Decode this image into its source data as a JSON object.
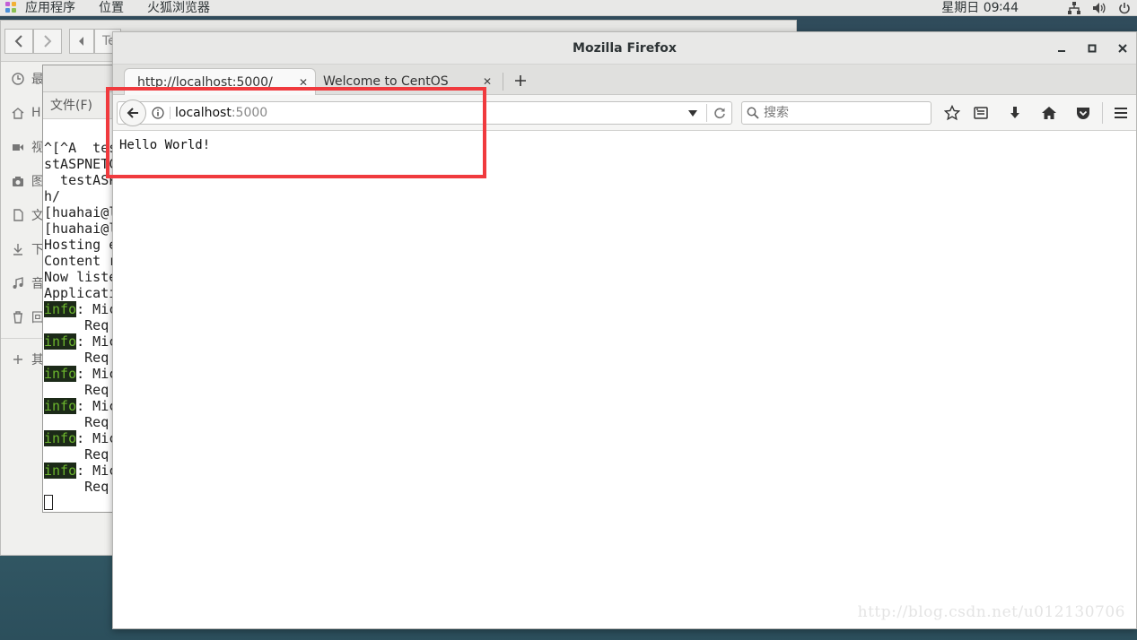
{
  "topbar": {
    "apps_label": "应用程序",
    "places_label": "位置",
    "browser_label": "火狐浏览器",
    "clock": "星期日 09∶44"
  },
  "file_manager": {
    "sidebar_items": [
      "最",
      "H",
      "视",
      "图",
      "文",
      "下",
      "音",
      "回",
      "其"
    ],
    "tab_hint": "Te"
  },
  "terminal": {
    "menu_file": "文件(F)",
    "lines": [
      "^[^A  tes",
      "stASPNETC",
      "  testASP",
      "h/",
      "[huahai@l",
      "[huahai@l",
      "Hosting e",
      "Content r",
      "Now liste",
      "Applicati"
    ],
    "info_tag": "info",
    "info_line": ": Mic",
    "req_line": "     Req"
  },
  "firefox": {
    "window_title": "Mozilla Firefox",
    "tabs": [
      {
        "label": "http://localhost:5000/"
      },
      {
        "label": "Welcome to CentOS"
      }
    ],
    "url_host": "localhost",
    "url_port": ":5000",
    "search_placeholder": "搜索",
    "page_text": "Hello World!"
  },
  "watermark": "http://blog.csdn.net/u012130706"
}
